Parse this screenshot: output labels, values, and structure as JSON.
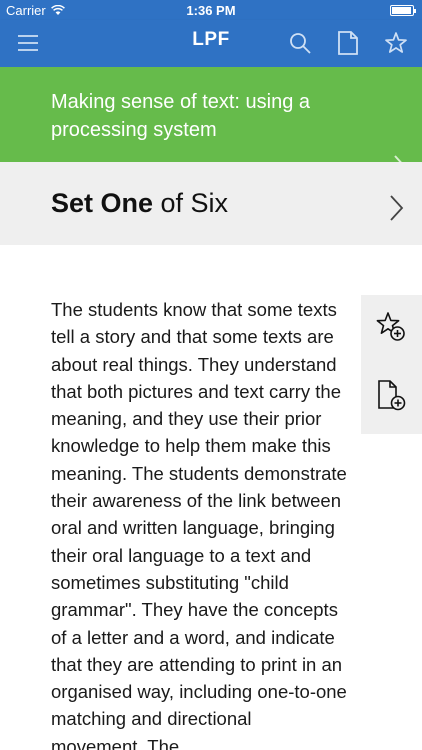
{
  "status_bar": {
    "carrier": "Carrier",
    "time": "1:36 PM",
    "battery_level": 0.95
  },
  "nav_bar": {
    "title": "LPF",
    "icons": [
      "menu-icon",
      "search-icon",
      "document-icon",
      "star-icon"
    ]
  },
  "section_banner": {
    "title": "Making sense of text: using a processing system"
  },
  "set_selector": {
    "bold": "Set One",
    "rest": " of Six"
  },
  "body_text": "The students know that some texts tell a story and that some texts are about real things. They understand that both pictures and text carry the meaning, and they use their prior knowledge to help them make this meaning. The students demonstrate their awareness of the link between oral and written language, bringing their oral language to a text and sometimes substituting \"child grammar\". They have the concepts of a letter and a word, and indicate that they are attending to print in an organised way, including one-to-one matching and directional movement. The",
  "side_tools": [
    "add-favourite-icon",
    "add-note-icon"
  ],
  "colors": {
    "nav": "#2f72c4",
    "banner": "#66bb4b",
    "set_row": "#efefef"
  }
}
